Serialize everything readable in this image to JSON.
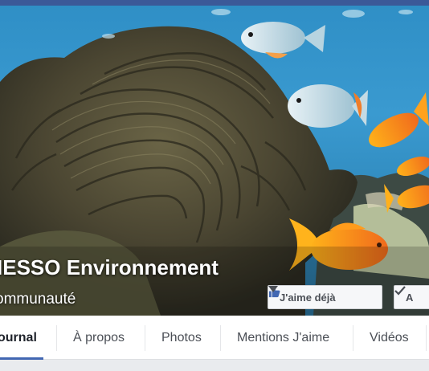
{
  "cover": {
    "page_name": "IESSO Environnement",
    "category": "ommunauté"
  },
  "actions": {
    "like_label": "J'aime déjà",
    "follow_label": "A",
    "like_icon": "thumbs-up-icon",
    "follow_icon": "check-icon"
  },
  "tabs": [
    {
      "label": "ournal",
      "active": true
    },
    {
      "label": "À propos",
      "active": false
    },
    {
      "label": "Photos",
      "active": false
    },
    {
      "label": "Mentions J'aime",
      "active": false
    },
    {
      "label": "Vidéos",
      "active": false
    }
  ],
  "colors": {
    "brand": "#3b5998",
    "active_tab_underline": "#4267b2",
    "like_icon": "#4267b2"
  }
}
